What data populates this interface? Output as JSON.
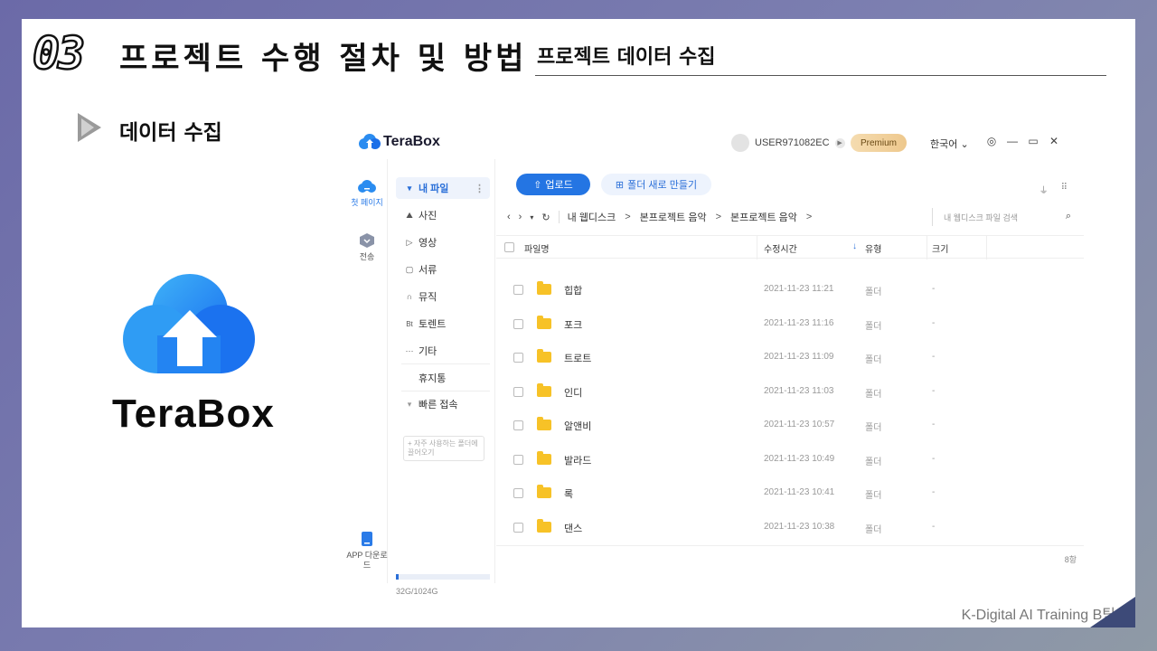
{
  "slide": {
    "number": "03",
    "title": "프로젝트 수행 절차 및 방법",
    "subtitle": "프로젝트 데이터 수집",
    "section": "데이터 수집",
    "logo_text": "TeraBox",
    "footer": "K-Digital AI Training B팀"
  },
  "app": {
    "brand": "TeraBox",
    "user": "USER971082EC",
    "premium": "Premium",
    "language": "한국어",
    "leftbar": [
      {
        "label": "첫 페이지",
        "icon": "cloud-icon"
      },
      {
        "label": "전송",
        "icon": "transfer-icon"
      },
      {
        "label": "APP 다운로드",
        "icon": "phone-icon"
      }
    ],
    "sidebar": {
      "my_files": "내 파일",
      "items": [
        {
          "label": "사진",
          "icon": "photo-icon",
          "glyph": "⛰"
        },
        {
          "label": "영상",
          "icon": "video-icon",
          "glyph": "▷"
        },
        {
          "label": "서류",
          "icon": "document-icon",
          "glyph": "▢"
        },
        {
          "label": "뮤직",
          "icon": "headphones-icon",
          "glyph": "∩"
        },
        {
          "label": "토렌트",
          "icon": "torrent-icon",
          "glyph": "Bt"
        },
        {
          "label": "기타",
          "icon": "more-icon",
          "glyph": "···"
        }
      ],
      "trash": "휴지통",
      "quick_access": "빠른 접속",
      "quick_hint": "+ 자주 사용하는 폴더에 끌어오기",
      "storage": "32G/1024G",
      "storage_fraction": 0.03
    },
    "toolbar": {
      "upload": "업로드",
      "new_folder": "폴더 새로 만들기"
    },
    "breadcrumb": [
      "내 웹디스크",
      "본프로젝트 음악",
      "본프로젝트 음악"
    ],
    "search_placeholder": "내 웹디스크 파일 검색",
    "columns": {
      "name": "파일명",
      "modified": "수정시간",
      "type": "유형",
      "size": "크기"
    },
    "files": [
      {
        "name": "힙합",
        "date": "2021-11-23 11:21",
        "type": "폴더",
        "size": "-"
      },
      {
        "name": "포크",
        "date": "2021-11-23 11:16",
        "type": "폴더",
        "size": "-"
      },
      {
        "name": "트로트",
        "date": "2021-11-23 11:09",
        "type": "폴더",
        "size": "-"
      },
      {
        "name": "인디",
        "date": "2021-11-23 11:03",
        "type": "폴더",
        "size": "-"
      },
      {
        "name": "알앤비",
        "date": "2021-11-23 10:57",
        "type": "폴더",
        "size": "-"
      },
      {
        "name": "발라드",
        "date": "2021-11-23 10:49",
        "type": "폴더",
        "size": "-"
      },
      {
        "name": "록",
        "date": "2021-11-23 10:41",
        "type": "폴더",
        "size": "-"
      },
      {
        "name": "댄스",
        "date": "2021-11-23 10:38",
        "type": "폴더",
        "size": "-"
      }
    ],
    "item_count": "8항"
  },
  "colors": {
    "accent": "#2475e3",
    "folder": "#f7c227",
    "premium": "#eec88d"
  }
}
